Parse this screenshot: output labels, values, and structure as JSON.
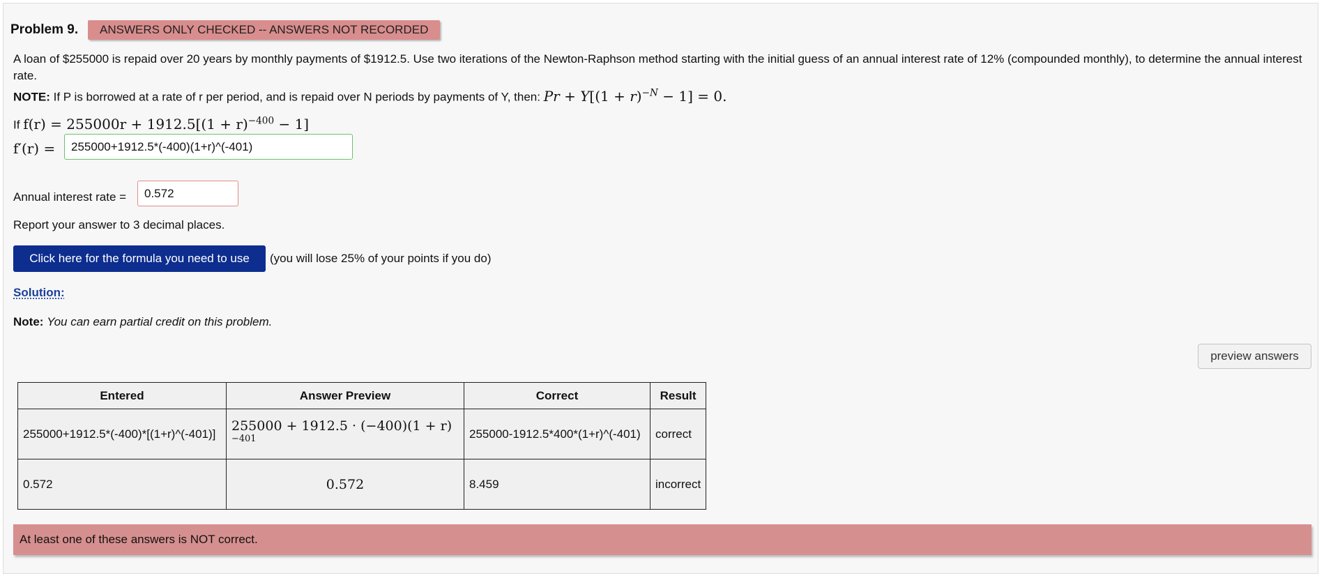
{
  "problem": {
    "title": "Problem 9.",
    "status_banner": "ANSWERS ONLY CHECKED -- ANSWERS NOT RECORDED",
    "statement": "A loan of $255000 is repaid over 20 years by monthly payments of $1912.5. Use two iterations of the Newton-Raphson method starting with the initial guess of an annual interest rate of 12% (compounded monthly), to determine the annual interest rate.",
    "note_label": "NOTE:",
    "note_text": "If P is borrowed at a rate of r per period, and is repaid over N periods by payments of Y, then:",
    "f_prefix": "If",
    "f_lhs": "f(r) = 255000r + 1912.5[(1 + r)",
    "f_exp": "−400",
    "f_tail": " − 1]",
    "fprime_label": "f′(r) =",
    "fprime_value": "255000+1912.5*(-400)(1+r)^(-401)",
    "rate_label": "Annual interest rate =",
    "rate_value": "0.572",
    "report_text": "Report your answer to 3 decimal places.",
    "formula_button": "Click here for the formula you need to use",
    "penalty_note": "(you will lose 25% of your points if you do)",
    "solution_label": "Solution:",
    "partial_note_label": "Note:",
    "partial_note_text": "You can earn partial credit on this problem.",
    "preview_button": "preview answers"
  },
  "results": {
    "headers": [
      "Entered",
      "Answer Preview",
      "Correct",
      "Result"
    ],
    "rows": [
      {
        "entered": "255000+1912.5*(-400)*[(1+r)^(-401)]",
        "preview_base": "255000 + 1912.5 · (−400)(1 + r)",
        "preview_exp": "−401",
        "correct": "255000-1912.5*400*(1+r)^(-401)",
        "result": "correct"
      },
      {
        "entered": "0.572",
        "preview_base": "0.572",
        "correct": "8.459",
        "result": "incorrect"
      }
    ],
    "summary": "At least one of these answers is NOT correct."
  },
  "colors": {
    "status_banner": "#d98d8d",
    "formula_button": "#0d2d8f",
    "correct_border": "#6fbf6f",
    "incorrect_border": "#e08c8c"
  }
}
